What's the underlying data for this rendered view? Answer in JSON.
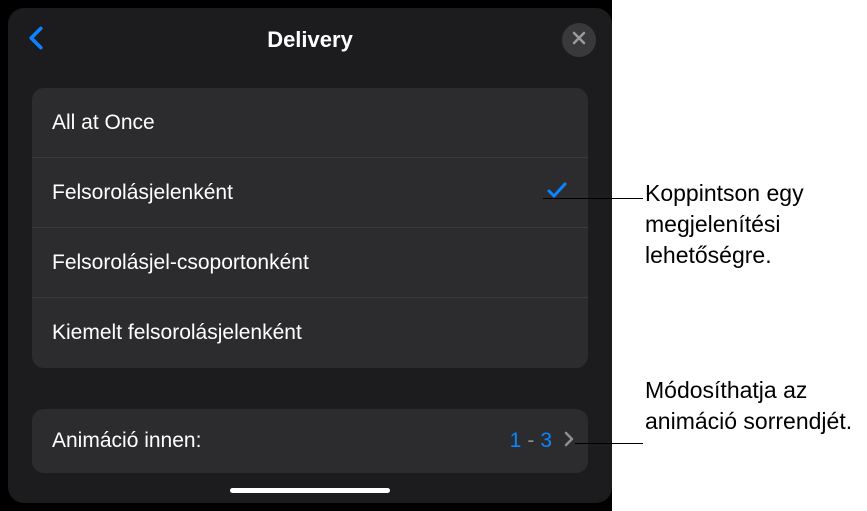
{
  "header": {
    "title": "Delivery"
  },
  "options": [
    {
      "label": "All at Once",
      "selected": false
    },
    {
      "label": "Felsorolásjelenként",
      "selected": true
    },
    {
      "label": "Felsorolásjel-csoportonként",
      "selected": false
    },
    {
      "label": "Kiemelt felsorolásjelenként",
      "selected": false
    }
  ],
  "animate": {
    "label": "Animáció innen:",
    "from": "1",
    "to": "3",
    "dash": "-"
  },
  "callouts": {
    "c1": "Koppintson egy megjelenítési lehetőségre.",
    "c2": "Módosíthatja az animáció sorrendjét."
  }
}
